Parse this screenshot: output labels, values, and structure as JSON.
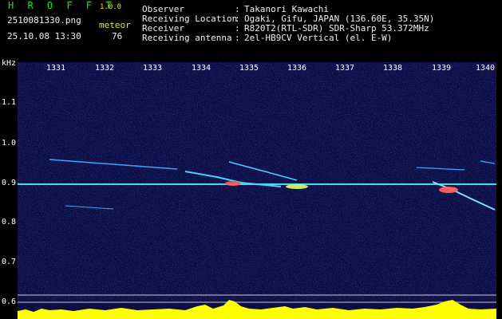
{
  "app": {
    "title": "H R O F F T",
    "version": "1.0.0"
  },
  "file": {
    "name": "2510081330.png",
    "timestamp": "25.10.08 13:30"
  },
  "meteor": {
    "label": "meteor",
    "count": "76"
  },
  "info": [
    {
      "label": "Observer",
      "value": "Takanori Kawachi"
    },
    {
      "label": "Receiving Location",
      "value": "Ogaki, Gifu, JAPAN (136.60E, 35.35N)"
    },
    {
      "label": "Receiver",
      "value": "R820T2(RTL-SDR) SDR-Sharp 53.372MHz"
    },
    {
      "label": "Receiving antenna",
      "value": "2el-HB9CV Vertical (el. E-W)"
    }
  ],
  "y_axis": {
    "unit": "kHz",
    "ticks": [
      "1.1",
      "1.0",
      "0.9",
      "0.8",
      "0.7",
      "0.6"
    ]
  },
  "x_axis": {
    "ticks": [
      "1331",
      "1332",
      "1333",
      "1334",
      "1335",
      "1336",
      "1337",
      "1338",
      "1339",
      "1340"
    ]
  },
  "colors": {
    "background": "#10124a",
    "carrier": "#40e0e0",
    "meteor": "#30c0ff",
    "histogram": "#ffff00"
  }
}
